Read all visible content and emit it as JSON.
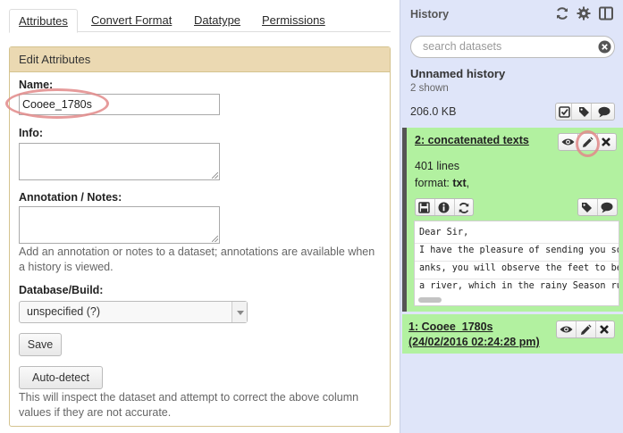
{
  "tabs": [
    {
      "label": "Attributes"
    },
    {
      "label": "Convert Format"
    },
    {
      "label": "Datatype"
    },
    {
      "label": "Permissions"
    }
  ],
  "edit": {
    "heading": "Edit Attributes",
    "name_label": "Name:",
    "name_value": "Cooee_1780s",
    "info_label": "Info:",
    "annotation_label": "Annotation / Notes:",
    "annotation_help": "Add an annotation or notes to a dataset; annotations are available when a history is viewed.",
    "db_label": "Database/Build:",
    "db_value": "unspecified (?)",
    "save_label": "Save",
    "autodetect_label": "Auto-detect",
    "autodetect_help": "This will inspect the dataset and attempt to correct the above column values if they are not accurate."
  },
  "history": {
    "title": "History",
    "search_placeholder": "search datasets",
    "name": "Unnamed history",
    "shown": "2 shown",
    "size": "206.0 KB",
    "datasets": [
      {
        "title": "2: concatenated texts",
        "lines": "401 lines",
        "format_label": "format:",
        "format_value": "txt",
        "format_suffix": ",",
        "peek": [
          "Dear Sir,",
          "I have the pleasure of sending you so",
          "anks, you will observe the feet to be",
          "a river, which in the rainy Season ru"
        ]
      },
      {
        "title": "1: Cooee_1780s (24/02/2016 02:24:28 pm)"
      }
    ]
  },
  "colors": {
    "dataset_ok": "#b2f1a0",
    "history_bg": "#dfe5f9",
    "panel_header": "#ebd9b2",
    "highlight": "#e28a8a"
  },
  "icons": [
    "refresh-icon",
    "gear-icon",
    "columns-icon",
    "clear-search-icon",
    "check-square-icon",
    "tags-icon",
    "comment-icon",
    "eye-icon",
    "pencil-icon",
    "close-icon",
    "save-icon",
    "info-icon",
    "rerun-icon"
  ]
}
